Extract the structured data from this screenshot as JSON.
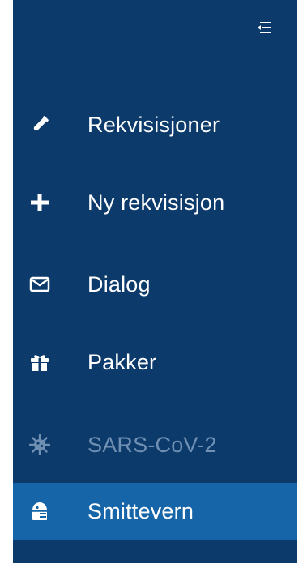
{
  "sidebar": {
    "toggle_icon": "collapse-menu-icon",
    "items": [
      {
        "label": "Rekvisisjoner",
        "icon": "test-tube-icon",
        "state": "normal"
      },
      {
        "label": "Ny rekvisisjon",
        "icon": "plus-icon",
        "state": "normal"
      },
      {
        "label": "Dialog",
        "icon": "envelope-icon",
        "state": "normal"
      },
      {
        "label": "Pakker",
        "icon": "gift-icon",
        "state": "normal"
      },
      {
        "label": "SARS-CoV-2",
        "icon": "virus-icon",
        "state": "disabled"
      },
      {
        "label": "Smittevern",
        "icon": "infection-control-icon",
        "state": "active"
      }
    ]
  },
  "colors": {
    "sidebar_bg": "#0c3a6b",
    "active_bg": "#1665a8",
    "text": "#ffffff",
    "disabled_text": "#6f8fb3"
  }
}
